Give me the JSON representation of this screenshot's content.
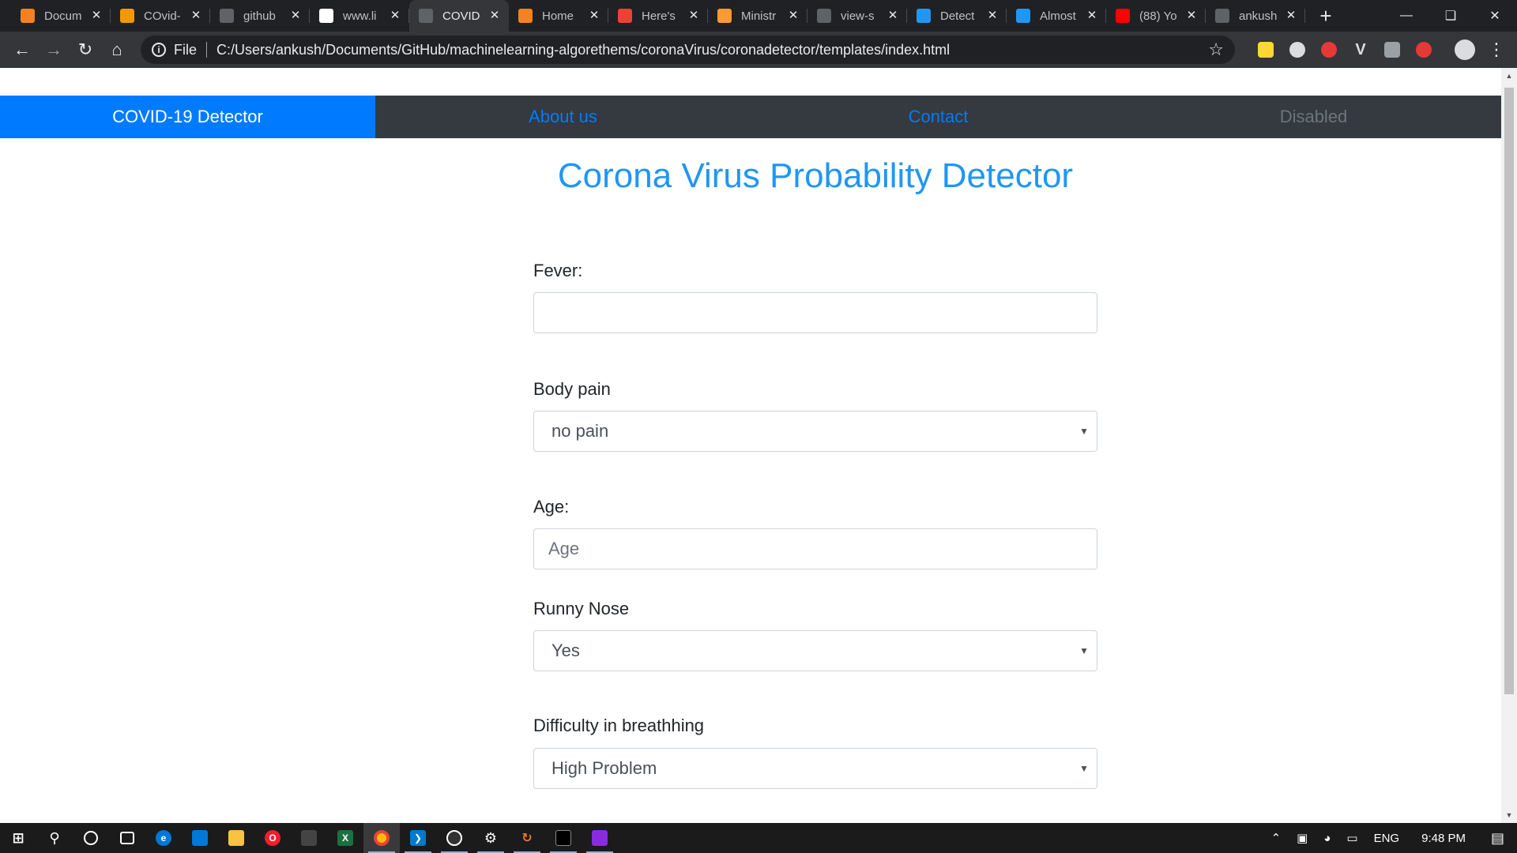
{
  "browser": {
    "tabs": [
      {
        "title": "Docum",
        "icon": "sync-orange-icon",
        "color": "#f5821f"
      },
      {
        "title": "COvid-",
        "icon": "book-icon",
        "color": "#f29900"
      },
      {
        "title": "github",
        "icon": "github-icon",
        "color": "#5f6368"
      },
      {
        "title": "www.li",
        "icon": "linkedin-icon",
        "color": "#ffffff"
      },
      {
        "title": "COVID",
        "icon": "globe-icon",
        "color": "#5f6368"
      },
      {
        "title": "Home",
        "icon": "sync-orange-icon",
        "color": "#f5821f"
      },
      {
        "title": "Here's",
        "icon": "gmail-icon",
        "color": "#ea4335"
      },
      {
        "title": "Ministr",
        "icon": "india-flag-icon",
        "color": "#ff9933"
      },
      {
        "title": "view-s",
        "icon": "globe-icon",
        "color": "#5f6368"
      },
      {
        "title": "Detect",
        "icon": "pi-icon",
        "color": "#2196f3"
      },
      {
        "title": "Almost",
        "icon": "pi-icon",
        "color": "#2196f3"
      },
      {
        "title": "(88) Yo",
        "icon": "youtube-icon",
        "color": "#ff0000"
      },
      {
        "title": "ankush",
        "icon": "github-icon",
        "color": "#5f6368"
      }
    ],
    "active_tab_index": 4,
    "address": {
      "scheme_label": "File",
      "url": "C:/Users/ankush/Documents/GitHub/machinelearning-algorethems/coronaVirus/coronadetector/templates/index.html"
    }
  },
  "site_nav": {
    "items": [
      {
        "label": "COVID-19 Detector",
        "state": "active"
      },
      {
        "label": "About us",
        "state": "link"
      },
      {
        "label": "Contact",
        "state": "link"
      },
      {
        "label": "Disabled",
        "state": "disabled"
      }
    ]
  },
  "page": {
    "title": "Corona Virus Probability Detector",
    "form": {
      "fever": {
        "label": "Fever:",
        "value": ""
      },
      "body_pain": {
        "label": "Body pain",
        "selected": "no pain"
      },
      "age": {
        "label": "Age:",
        "placeholder": "Age"
      },
      "runny_nose": {
        "label": "Runny Nose",
        "selected": "Yes"
      },
      "difficulty_breathing": {
        "label": "Difficulty in breathhing",
        "selected": "High Problem"
      }
    }
  },
  "taskbar": {
    "language": "ENG",
    "time": "9:48 PM"
  },
  "colors": {
    "accent": "#007bff",
    "heading": "#2196f3",
    "navbar": "#343a40"
  }
}
